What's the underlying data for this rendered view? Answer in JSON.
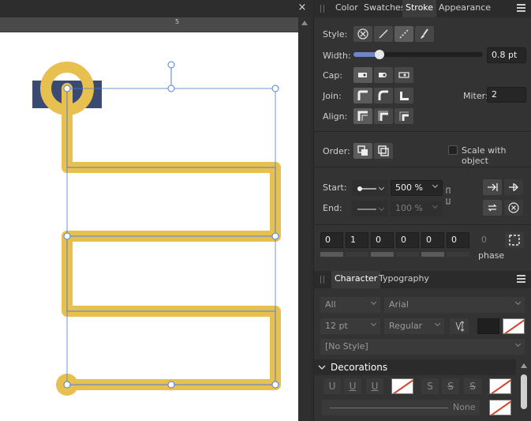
{
  "canvas": {
    "close_glyph": "×",
    "ruler_label": "5",
    "colors": {
      "stroke": "#e8c050",
      "accent_rect": "#3b4a72",
      "selection": "#4a7fd8"
    }
  },
  "tabs": {
    "color": "Color",
    "swatches": "Swatches",
    "stroke": "Stroke",
    "appearance": "Appearance"
  },
  "stroke": {
    "style_label": "Style:",
    "width_label": "Width:",
    "width_value": "0.8 pt",
    "width_slider_fraction": 0.2,
    "cap_label": "Cap:",
    "join_label": "Join:",
    "miter_label": "Miter:",
    "miter_value": "2",
    "align_label": "Align:",
    "order_label": "Order:",
    "scale_label": "Scale with object",
    "start_label": "Start:",
    "start_scale": "500 %",
    "end_label": "End:",
    "end_scale": "100 %",
    "dash_values": [
      "0",
      "1",
      "0",
      "0",
      "0",
      "0"
    ],
    "phase_value": "0",
    "phase_label": "phase"
  },
  "character_tabs": {
    "character": "Character",
    "typography": "Typography"
  },
  "character": {
    "category": "All",
    "font": "Arial",
    "size": "12 pt",
    "weight": "Regular",
    "style": "[No Style]"
  },
  "decorations": {
    "header": "Decorations",
    "u_labels": [
      "U",
      "U",
      "U"
    ],
    "s_labels": [
      "S",
      "S",
      "S"
    ],
    "none_label": "None"
  }
}
